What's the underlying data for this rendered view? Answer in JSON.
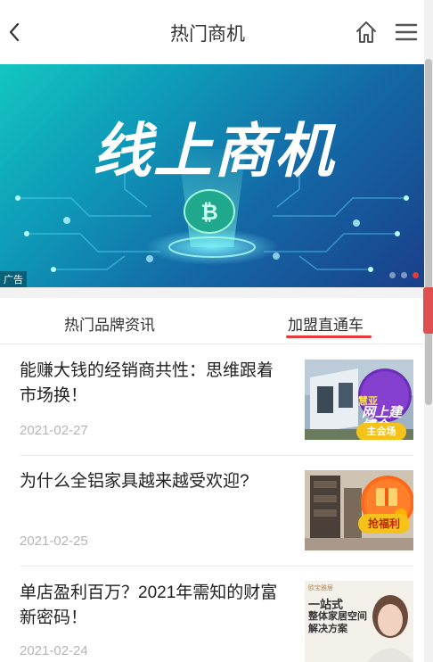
{
  "header": {
    "title": "热门商机"
  },
  "banner": {
    "headline": "线上商机",
    "ad_label": "广告",
    "slide_count": 3,
    "active_slide": 3
  },
  "tabs": [
    {
      "label": "热门品牌资讯",
      "active": false
    },
    {
      "label": "加盟直通车",
      "active": true
    }
  ],
  "news": [
    {
      "title": "能赚大钱的经销商共性：思维跟着市场换！",
      "date": "2021-02-27",
      "thumb": {
        "badge_top": "慧亚",
        "badge_main": "网上建博会",
        "badge_bottom": "主会场"
      }
    },
    {
      "title": "为什么全铝家具越来越受欢迎?",
      "date": "2021-02-25",
      "thumb": {
        "badge_bottom": "抢福利"
      }
    },
    {
      "title": "单店盈利百万？2021年需知的财富新密码！",
      "date": "2021-02-24",
      "thumb": {
        "brand": "欧宝雅居",
        "line1": "一站式",
        "line2": "整体家居空间",
        "line3": "解决方案"
      }
    }
  ],
  "colors": {
    "accent": "#e73a3a",
    "date_gray": "#b5b5b5"
  }
}
